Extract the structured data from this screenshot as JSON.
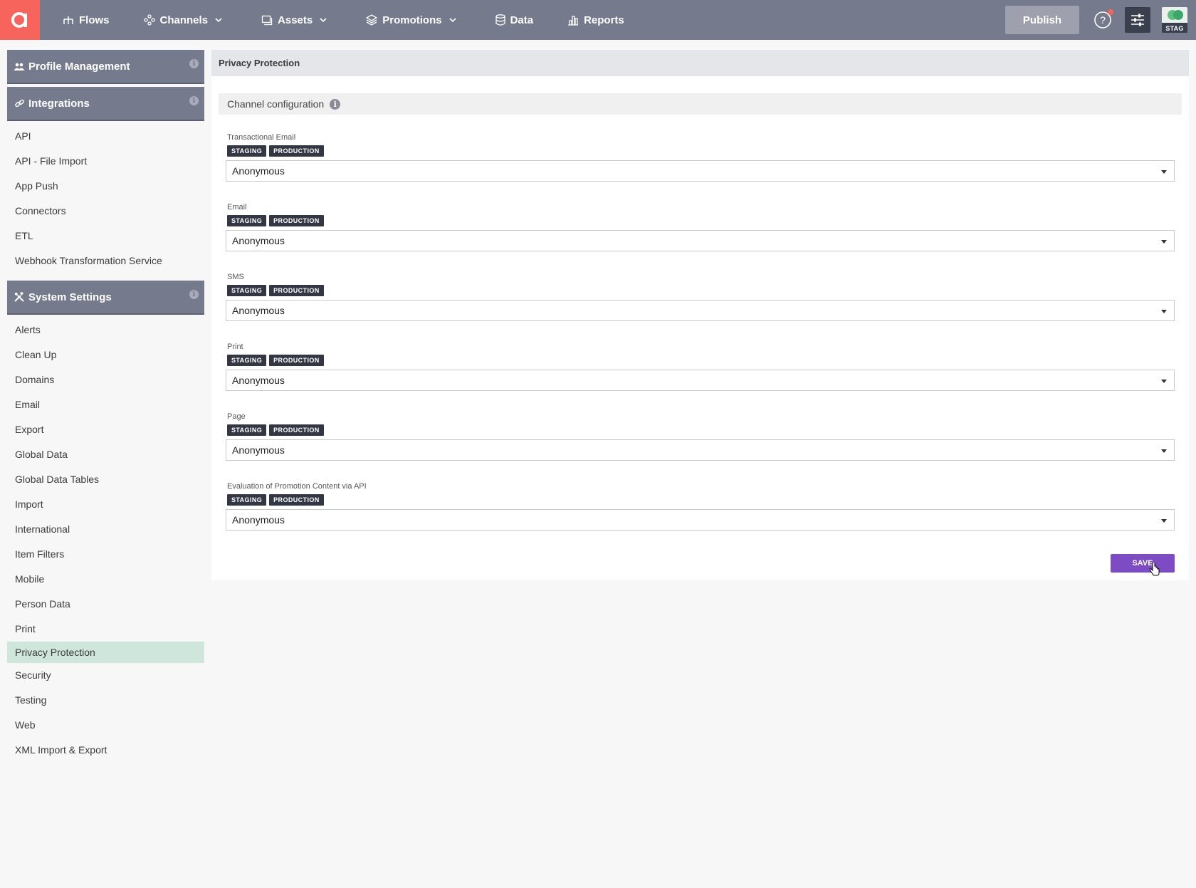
{
  "topnav": {
    "items": [
      {
        "label": "Flows",
        "icon": "flows-icon",
        "dropdown": false
      },
      {
        "label": "Channels",
        "icon": "channels-icon",
        "dropdown": true
      },
      {
        "label": "Assets",
        "icon": "assets-icon",
        "dropdown": true
      },
      {
        "label": "Promotions",
        "icon": "promotions-icon",
        "dropdown": true
      },
      {
        "label": "Data",
        "icon": "database-icon",
        "dropdown": false
      },
      {
        "label": "Reports",
        "icon": "bar-chart-icon",
        "dropdown": false
      }
    ],
    "publish_label": "Publish",
    "environment_label": "STAG"
  },
  "sidebar": {
    "groups": [
      {
        "title": "Profile Management",
        "icon": "people-icon",
        "items": []
      },
      {
        "title": "Integrations",
        "icon": "link-icon",
        "items": [
          "API",
          "API - File Import",
          "App Push",
          "Connectors",
          "ETL",
          "Webhook Transformation Service"
        ]
      },
      {
        "title": "System Settings",
        "icon": "tools-icon",
        "items": [
          "Alerts",
          "Clean Up",
          "Domains",
          "Email",
          "Export",
          "Global Data",
          "Global Data Tables",
          "Import",
          "International",
          "Item Filters",
          "Mobile",
          "Person Data",
          "Print",
          "Privacy Protection",
          "Security",
          "Testing",
          "Web",
          "XML Import & Export"
        ]
      }
    ],
    "active_item": "Privacy Protection"
  },
  "main": {
    "title": "Privacy Protection",
    "section_title": "Channel configuration",
    "tags": [
      "STAGING",
      "PRODUCTION"
    ],
    "fields": [
      {
        "label": "Transactional Email",
        "value": "Anonymous"
      },
      {
        "label": "Email",
        "value": "Anonymous"
      },
      {
        "label": "SMS",
        "value": "Anonymous"
      },
      {
        "label": "Print",
        "value": "Anonymous"
      },
      {
        "label": "Page",
        "value": "Anonymous"
      },
      {
        "label": "Evaluation of Promotion Content via API",
        "value": "Anonymous"
      }
    ],
    "save_label": "SAVE"
  },
  "colors": {
    "topbar": "#757a8c",
    "logo": "#f7645c",
    "active_item": "#cfe6dc",
    "save_button": "#7d4cc4",
    "tag": "#333744"
  }
}
